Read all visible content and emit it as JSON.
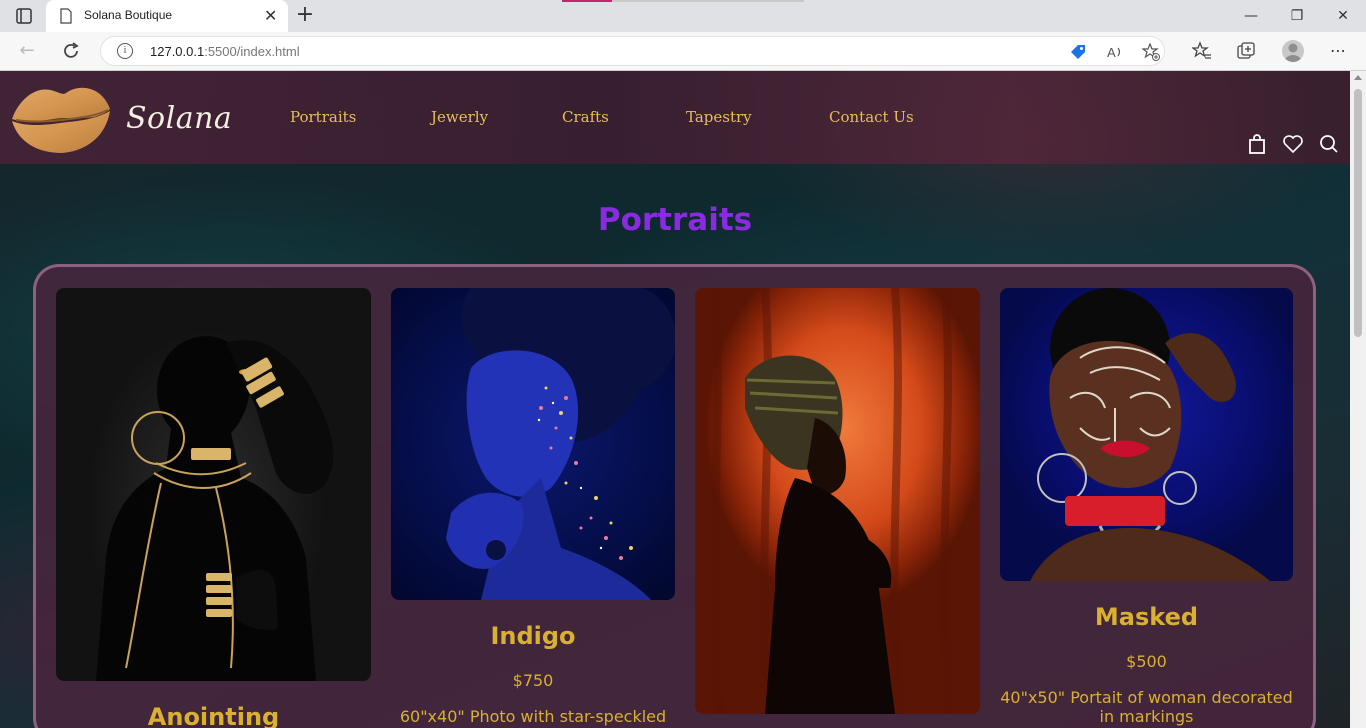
{
  "browser": {
    "tab_title": "Solana Boutique",
    "url_host": "127.0.0.1",
    "url_rest": ":5500/index.html"
  },
  "site": {
    "brand": "Solana",
    "nav": [
      "Portraits",
      "Jewerly",
      "Crafts",
      "Tapestry",
      "Contact Us"
    ]
  },
  "section": {
    "title": "Portraits"
  },
  "products": [
    {
      "title": "Anointing",
      "price": "",
      "description": ""
    },
    {
      "title": "Indigo",
      "price": "$750",
      "description": "60\"x40\" Photo with star-speckled"
    },
    {
      "title": "",
      "price": "",
      "description": ""
    },
    {
      "title": "Masked",
      "price": "$500",
      "description": "40\"x50\" Portait of woman decorated in markings"
    }
  ],
  "icons": {
    "header": [
      "shopping-bag-icon",
      "heart-icon",
      "search-icon"
    ]
  },
  "colors": {
    "section_title": "#8a2be2",
    "nav_text": "#e6bf55",
    "card_text": "#d9b030",
    "header_bg": "#4a2538"
  }
}
